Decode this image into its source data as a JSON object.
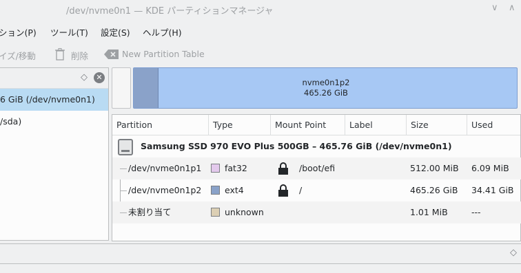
{
  "window": {
    "title": "/dev/nvme0n1 — KDE パーティションマネージャ"
  },
  "menu": [
    "ション(P)",
    "ツール(T)",
    "設定(S)",
    "ヘルプ(H)"
  ],
  "toolbar": {
    "resize_label": "イズ/移動",
    "delete_label": "削除",
    "new_table_label": "New Partition Table"
  },
  "devices": [
    {
      "label": "6 GiB (/dev/nvme0n1)",
      "selected": true
    },
    {
      "label": "/sda)",
      "selected": false
    }
  ],
  "graph": {
    "name": "nvme0n1p2",
    "size": "465.26 GiB"
  },
  "table": {
    "headers": [
      "Partition",
      "Type",
      "Mount Point",
      "Label",
      "Size",
      "Used"
    ],
    "disk": "Samsung SSD 970 EVO Plus 500GB – 465.76 GiB (/dev/nvme0n1)",
    "rows": [
      {
        "partition": "/dev/nvme0n1p1",
        "type": "fat32",
        "type_color": "#e3c9ec",
        "locked": true,
        "mount": "/boot/efi",
        "label": "",
        "size": "512.00 MiB",
        "used": "6.09 MiB"
      },
      {
        "partition": "/dev/nvme0n1p2",
        "type": "ext4",
        "type_color": "#8aa2c9",
        "locked": true,
        "mount": "/",
        "label": "",
        "size": "465.26 GiB",
        "used": "34.41 GiB"
      },
      {
        "partition": "未割り当て",
        "type": "unknown",
        "type_color": "#dccfb4",
        "locked": false,
        "mount": "",
        "label": "",
        "size": "1.01 MiB",
        "used": "---"
      }
    ]
  }
}
